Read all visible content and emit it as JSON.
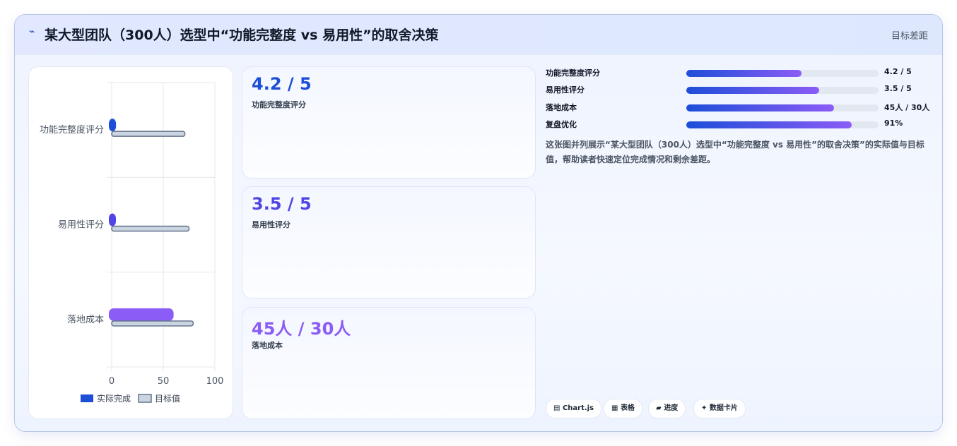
{
  "header": {
    "icon": "lightning-icon",
    "title": "某大型团队（300人）选型中“功能完整度 vs 易用性”的取舍决策",
    "tag": "目标差距"
  },
  "chart_data": {
    "type": "bar",
    "orientation": "horizontal",
    "categories": [
      "功能完整度评分",
      "易用性评分",
      "落地成本"
    ],
    "series": [
      {
        "name": "实际完成",
        "values": [
          4.2,
          3.5,
          60
        ],
        "colors": [
          "#1d4ed8",
          "#4f46e5",
          "#8b5cf6"
        ]
      },
      {
        "name": "目标值",
        "values": [
          71,
          75,
          79
        ],
        "color": "#cbd5e1"
      }
    ],
    "xlim": [
      0,
      100
    ],
    "xticks": [
      "0",
      "50",
      "100"
    ],
    "grid": true,
    "legend_position": "bottom"
  },
  "stats": [
    {
      "value": "4.2 / 5",
      "label": "功能完整度评分",
      "color": "#1d4ed8"
    },
    {
      "value": "3.5 / 5",
      "label": "易用性评分",
      "color": "#4f46e5"
    },
    {
      "value": "45人 / 30人",
      "label": "落地成本",
      "color": "#8b5cf6"
    }
  ],
  "metrics": [
    {
      "name": "功能完整度评分",
      "value": "4.2 / 5",
      "fill": 0.6
    },
    {
      "name": "易用性评分",
      "value": "3.5 / 5",
      "fill": 0.69
    },
    {
      "name": "落地成本",
      "value": "45人 / 30人",
      "fill": 0.77
    },
    {
      "name": "复盘优化",
      "value": "91%",
      "fill": 0.86
    }
  ],
  "description": "这张图并列展示“某大型团队（300人）选型中“功能完整度 vs 易用性”的取舍决策”的实际值与目标值，帮助读者快速定位完成情况和剩余差距。",
  "chips": [
    {
      "icon": "chart-icon",
      "label": "Chart.js",
      "glyph": "▤"
    },
    {
      "icon": "table-icon",
      "label": "表格",
      "glyph": "▦"
    },
    {
      "icon": "progress-icon",
      "label": "进度",
      "glyph": "▰"
    },
    {
      "icon": "sparkle-icon",
      "label": "数据卡片",
      "glyph": "✦"
    }
  ]
}
